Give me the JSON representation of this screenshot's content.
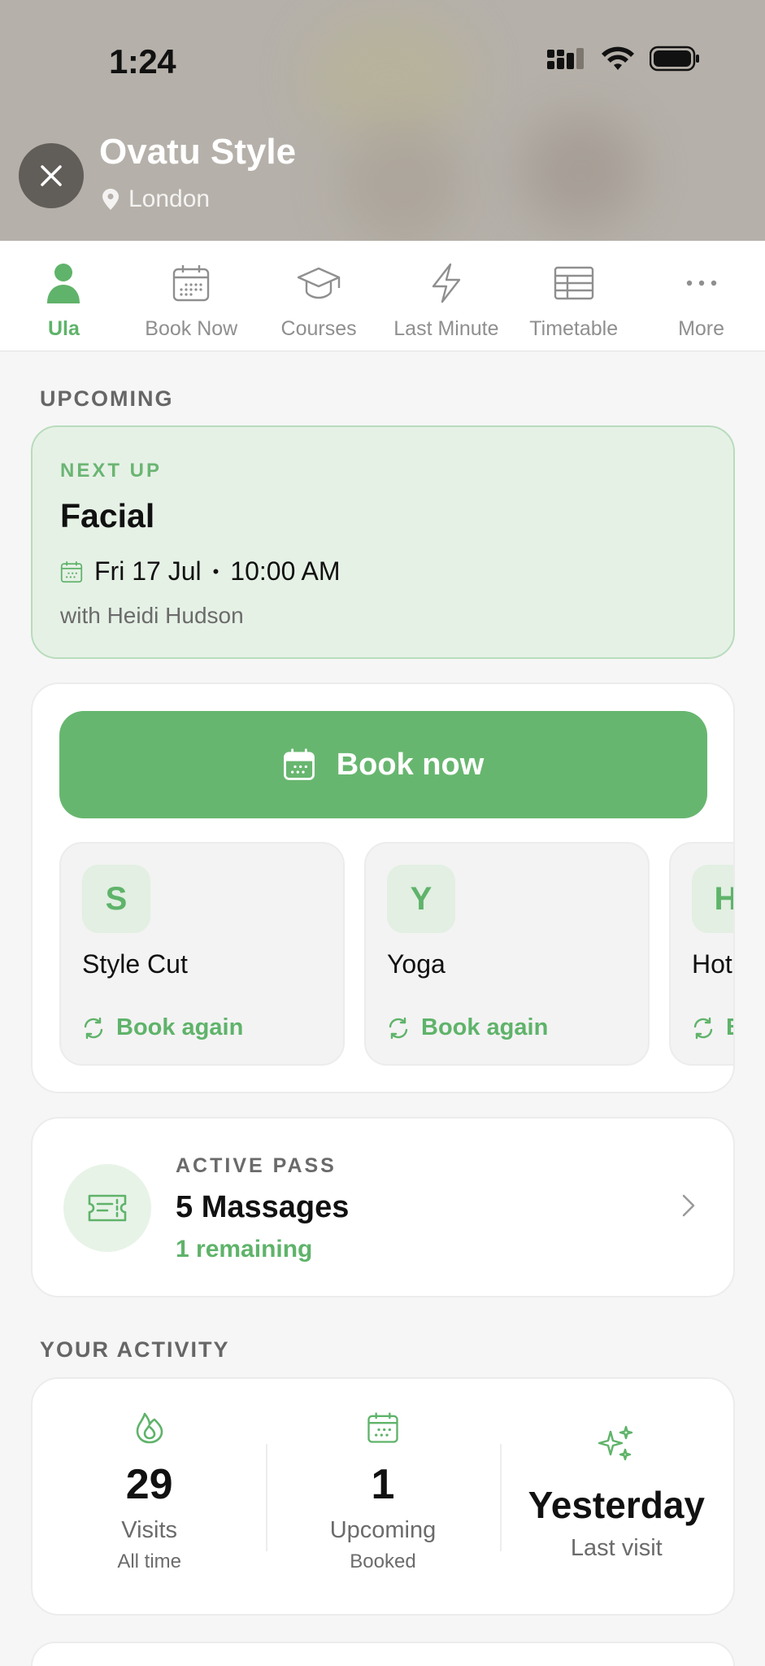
{
  "status_bar": {
    "time": "1:24"
  },
  "header": {
    "business_name": "Ovatu Style",
    "location": "London"
  },
  "tabs": [
    {
      "label": "Ula",
      "icon": "person-icon",
      "active": true
    },
    {
      "label": "Book Now",
      "icon": "calendar-icon"
    },
    {
      "label": "Courses",
      "icon": "graduation-cap-icon"
    },
    {
      "label": "Last Minute",
      "icon": "lightning-icon"
    },
    {
      "label": "Timetable",
      "icon": "table-icon"
    },
    {
      "label": "More",
      "icon": "more-dots-icon"
    }
  ],
  "upcoming": {
    "section_title": "UPCOMING",
    "next_label": "NEXT UP",
    "service": "Facial",
    "date": "Fri 17 Jul",
    "separator": "•",
    "time": "10:00 AM",
    "with": "with Heidi Hudson"
  },
  "booking": {
    "book_now_label": "Book now",
    "services": [
      {
        "initial": "S",
        "name": "Style Cut",
        "action": "Book again"
      },
      {
        "initial": "Y",
        "name": "Yoga",
        "action": "Book again"
      },
      {
        "initial": "H",
        "name": "Hot",
        "action": "Book again"
      }
    ]
  },
  "pass": {
    "label": "ACTIVE PASS",
    "title": "5 Massages",
    "remaining": "1 remaining"
  },
  "activity": {
    "section_title": "YOUR ACTIVITY",
    "stats": [
      {
        "value": "29",
        "label": "Visits",
        "sub": "All time",
        "icon": "flame-icon"
      },
      {
        "value": "1",
        "label": "Upcoming",
        "sub": "Booked",
        "icon": "calendar-icon"
      },
      {
        "value": "Yesterday",
        "label": "Last visit",
        "sub": "",
        "icon": "sparkles-icon"
      }
    ]
  },
  "colors": {
    "accent": "#67b66f",
    "accent_light": "#e6f1e6",
    "muted": "#8f8f8f"
  }
}
